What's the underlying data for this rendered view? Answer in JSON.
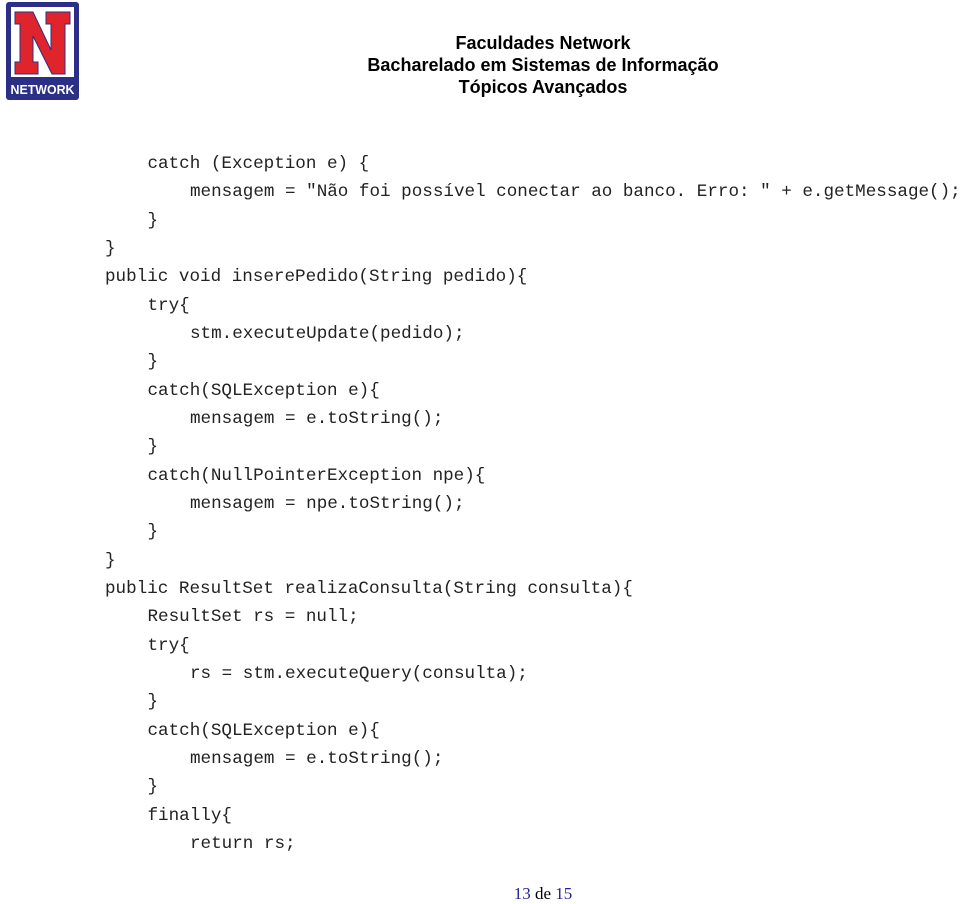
{
  "logo": {
    "text": "NETWORK",
    "letter": "N",
    "colors": {
      "border": "#2b2f86",
      "letter": "#e0242b"
    }
  },
  "header": {
    "line1": "Faculdades Network",
    "line2": "Bacharelado em Sistemas de Informação",
    "line3": "Tópicos Avançados"
  },
  "code": [
    {
      "indent": 1,
      "text": "catch (Exception e) {"
    },
    {
      "indent": 2,
      "text": "mensagem = \"Não foi possível conectar ao banco. Erro: \" + e.getMessage();"
    },
    {
      "indent": 1,
      "text": "}"
    },
    {
      "indent": 0,
      "text": "}"
    },
    {
      "indent": 0,
      "text": "public void inserePedido(String pedido){"
    },
    {
      "indent": 1,
      "text": "try{"
    },
    {
      "indent": 2,
      "text": "stm.executeUpdate(pedido);"
    },
    {
      "indent": 1,
      "text": "}"
    },
    {
      "indent": 1,
      "text": "catch(SQLException e){"
    },
    {
      "indent": 2,
      "text": "mensagem = e.toString();"
    },
    {
      "indent": 1,
      "text": "}"
    },
    {
      "indent": 1,
      "text": "catch(NullPointerException npe){"
    },
    {
      "indent": 2,
      "text": "mensagem = npe.toString();"
    },
    {
      "indent": 1,
      "text": "}"
    },
    {
      "indent": 0,
      "text": "}"
    },
    {
      "indent": 0,
      "text": "public ResultSet realizaConsulta(String consulta){"
    },
    {
      "indent": 1,
      "text": "ResultSet rs = null;"
    },
    {
      "indent": 1,
      "text": "try{"
    },
    {
      "indent": 2,
      "text": "rs = stm.executeQuery(consulta);"
    },
    {
      "indent": 1,
      "text": "}"
    },
    {
      "indent": 1,
      "text": "catch(SQLException e){"
    },
    {
      "indent": 2,
      "text": "mensagem = e.toString();"
    },
    {
      "indent": 1,
      "text": "}"
    },
    {
      "indent": 1,
      "text": "finally{"
    },
    {
      "indent": 2,
      "text": "return rs;"
    }
  ],
  "footer": {
    "page": "13",
    "of": "de",
    "total": "15"
  }
}
